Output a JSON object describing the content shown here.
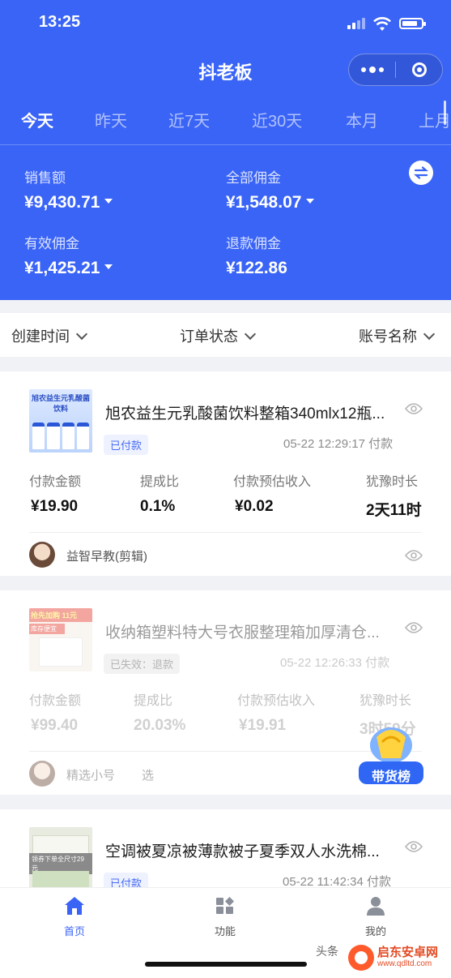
{
  "status_bar": {
    "time": "13:25"
  },
  "header": {
    "title": "抖老板"
  },
  "tabs": [
    "今天",
    "昨天",
    "近7天",
    "近30天",
    "本月",
    "上月"
  ],
  "stats": {
    "sales_label": "销售额",
    "sales_value": "¥9,430.71",
    "total_comm_label": "全部佣金",
    "total_comm_value": "¥1,548.07",
    "valid_comm_label": "有效佣金",
    "valid_comm_value": "¥1,425.21",
    "refund_comm_label": "退款佣金",
    "refund_comm_value": "¥122.86"
  },
  "filters": {
    "created_time": "创建时间",
    "order_status": "订单状态",
    "account_name": "账号名称"
  },
  "metric_labels": {
    "amount": "付款金额",
    "rate": "提成比",
    "income": "付款预估收入",
    "grace": "犹豫时长"
  },
  "orders": [
    {
      "title": "旭农益生元乳酸菌饮料整箱340mlx12瓶...",
      "badge": "已付款",
      "time": "05-22 12:29:17 付款",
      "amount": "¥19.90",
      "rate": "0.1%",
      "income": "¥0.02",
      "grace": "2天11时",
      "account": "益智早教(剪辑)"
    },
    {
      "title": "收纳箱塑料特大号衣服整理箱加厚清仓...",
      "badge": "已失效：退款",
      "time": "05-22 12:26:33 付款",
      "amount": "¥99.40",
      "rate": "20.03%",
      "income": "¥19.91",
      "grace": "3时59分",
      "account": "精选小号",
      "account_extra": "选"
    },
    {
      "title": "空调被夏凉被薄款被子夏季双人水洗棉...",
      "badge": "已付款",
      "time": "05-22 11:42:34 付款"
    }
  ],
  "thumb_text": {
    "o1": "旭农益生元乳酸菌饮料",
    "o2_top": "抢先加购 11元",
    "o2_mid": "库存便宜",
    "o3": "领券下单全尺寸29元"
  },
  "float_badge": "带货榜",
  "bottom_nav": [
    {
      "label": "首页",
      "icon": "home-icon",
      "active": true
    },
    {
      "label": "功能",
      "icon": "grid-icon",
      "active": false
    },
    {
      "label": "我的",
      "icon": "person-icon",
      "active": false
    }
  ],
  "watermark": {
    "toutiao": "头条",
    "site_name": "启东安卓网",
    "site_url": "www.qdltd.com"
  },
  "colors": {
    "primary": "#3a64f6",
    "background": "#f1f2f5"
  }
}
